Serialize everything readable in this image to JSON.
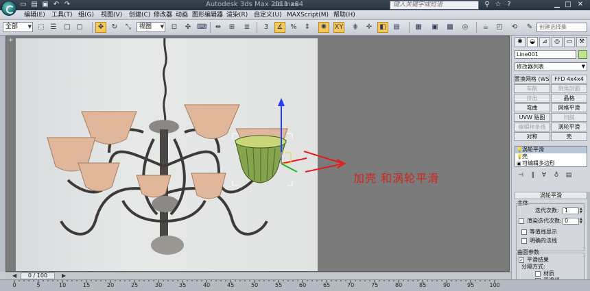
{
  "window": {
    "title": "Autodesk 3ds Max  2011 x64",
    "file": "dd.max",
    "help_search_placeholder": "键入关键字或短语"
  },
  "menu": [
    "编辑(E)",
    "工具(T)",
    "组(G)",
    "视图(V)",
    "创建(C)",
    "修改器",
    "动画",
    "图形编辑器",
    "渲染(R)",
    "自定义(U)",
    "MAXScript(M)",
    "帮助(H)"
  ],
  "toolbar": {
    "selection_filter": "全部",
    "reference_coord": "视图",
    "named_selection_placeholder": "创建选择集"
  },
  "viewport": {
    "label": "+",
    "annotation": "加壳   和涡轮平滑"
  },
  "command_panel": {
    "object_name": "Line001",
    "modifier_list": "修改器列表",
    "modifier_buttons": [
      {
        "label": "置换网格 (WSM)",
        "enabled": true
      },
      {
        "label": "FFD 4x4x4",
        "enabled": true
      },
      {
        "label": "车削",
        "enabled": false
      },
      {
        "label": "倒角剖面",
        "enabled": false
      },
      {
        "label": "挤出",
        "enabled": false
      },
      {
        "label": "晶格",
        "enabled": true
      },
      {
        "label": "弯曲",
        "enabled": true
      },
      {
        "label": "网格平滑",
        "enabled": true
      },
      {
        "label": "UVW 贴图",
        "enabled": true
      },
      {
        "label": "扫描",
        "enabled": false
      },
      {
        "label": "编辑样条线",
        "enabled": false
      },
      {
        "label": "涡轮平滑",
        "enabled": true
      },
      {
        "label": "对称",
        "enabled": true
      },
      {
        "label": "壳",
        "enabled": true
      }
    ],
    "stack": [
      "涡轮平滑",
      "壳",
      "可编辑多边形"
    ],
    "rollout": {
      "title": "涡轮平滑",
      "main_group": "主体",
      "iterations_label": "迭代次数:",
      "iterations_value": "1",
      "render_iters_label": "渲染迭代次数:",
      "render_iters_value": "0",
      "isoline_label": "等值线显示",
      "explicit_normals_label": "明确的法线",
      "surface_group": "曲面参数",
      "smooth_result_label": "平滑结果",
      "separate_by_label": "分隔方式:",
      "materials_label": "材质",
      "smoothing_groups_label": "平滑组"
    }
  },
  "timeline": {
    "frame_display": "0 / 100",
    "ticks": [
      "0",
      "5",
      "10",
      "15",
      "20",
      "25",
      "30",
      "35",
      "40",
      "45",
      "50",
      "55",
      "60",
      "65",
      "70",
      "75",
      "80",
      "85",
      "90",
      "95",
      "100"
    ]
  }
}
